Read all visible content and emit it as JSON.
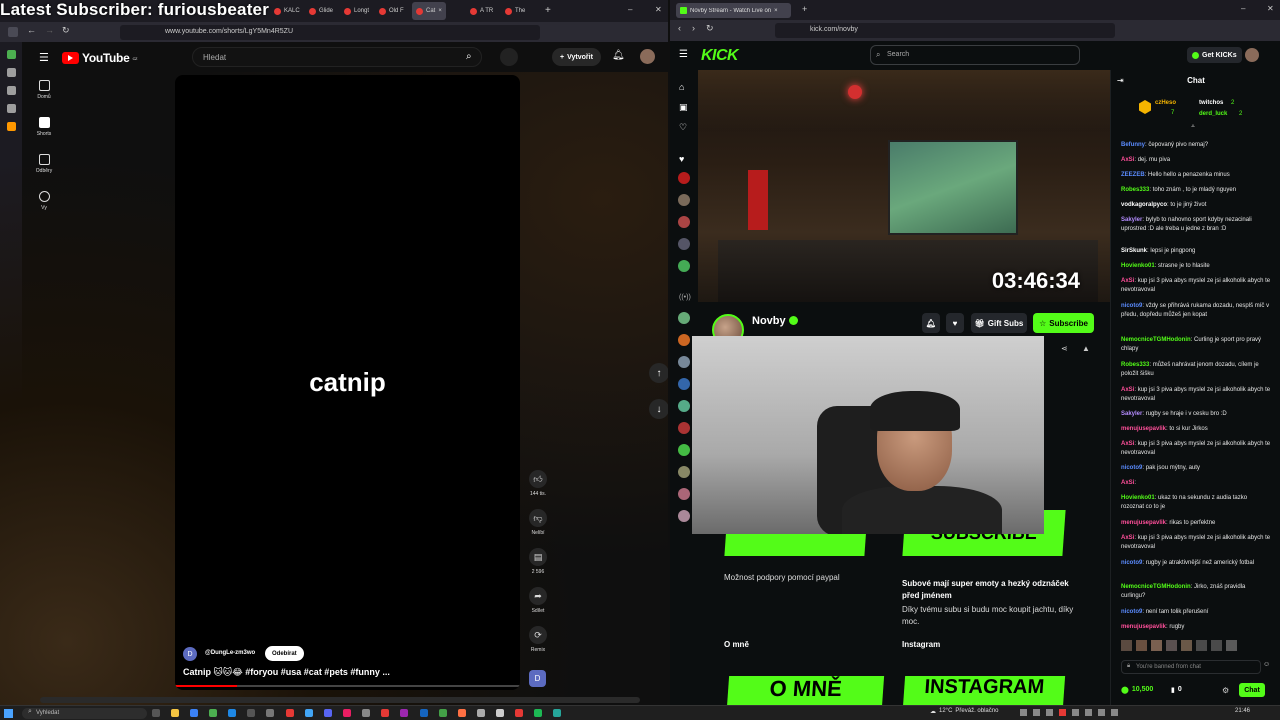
{
  "overlay_text": "Latest Subscriber: furiousbeater",
  "left_browser": {
    "tabs": [
      "KALC",
      "Glide",
      "Longt",
      "Old F",
      "Cat",
      "A TR",
      "The"
    ],
    "url": "www.youtube.com/shorts/LgY5Mn4R5ZU",
    "yt_logo": "YouTube",
    "yt_region": "CZ",
    "search_placeholder": "Hledat",
    "create_label": "Vytvořit",
    "nav": [
      {
        "label": "Domů",
        "icon": "home-icon"
      },
      {
        "label": "Shorts",
        "icon": "shorts-icon"
      },
      {
        "label": "Odběry",
        "icon": "subscriptions-icon"
      },
      {
        "label": "Vy",
        "icon": "you-icon"
      }
    ],
    "short_title": "catnip",
    "channel": "@DungLe-zm3wo",
    "subscribe_label": "Odebírat",
    "caption": "Catnip 🐱🐱😂 #foryou #usa #cat #pets #funny ...",
    "actions": {
      "likes": "144 tis.",
      "dislike": "Nelíbí",
      "comments": "2 596",
      "share": "Sdílet",
      "remix": "Remix"
    }
  },
  "right_browser": {
    "tab_title": "Novby Stream - Watch Live on",
    "url": "kick.com/novby",
    "logo": "KICK",
    "search_placeholder": "Search",
    "get_kicks": "Get KICKs",
    "timer": "03:46:34",
    "channel_name": "Novby",
    "gift_subs": "Gift Subs",
    "subscribe": "Subscribe",
    "panels": [
      {
        "text": "Možnost podpory pomocí paypal"
      },
      {
        "text": "Subové mají super emoty a hezký odznáček před jménem",
        "sub": "Díky tvému subu si budu moc koupit jachtu, díky moc."
      }
    ],
    "panel_banner_right": "SUBSCRIBE",
    "section_about": "O mně",
    "section_instagram": "Instagram",
    "banner_about": "O MNĚ",
    "banner_instagram": "INSTAGRAM"
  },
  "chat": {
    "title": "Chat",
    "top_gifters": [
      {
        "name": "czHeso",
        "count": "7"
      },
      {
        "name": "twitchos",
        "count": "2"
      },
      {
        "name": "derd_luck",
        "count": "2"
      }
    ],
    "messages": [
      {
        "user": "Befunny",
        "color": "#5b8cff",
        "text": "čepovaný pivo nemaj?"
      },
      {
        "user": "AxSi",
        "color": "#ff4f9a",
        "text": "dej. mu piva"
      },
      {
        "user": "ZEEZEB",
        "color": "#5b8cff",
        "text": "Hello hello a penazenka minus"
      },
      {
        "user": "Robes333",
        "color": "#53fc18",
        "text": "toho znám , to je mladý nguyen"
      },
      {
        "user": "vodkagoralpyco",
        "color": "#ffffff",
        "text": "to je jiný život"
      },
      {
        "user": "Sakyler",
        "color": "#b48cff",
        "text": "bylyb to nahovno sport kdyby nezacinali uprostred :D ale treba u jedne z bran :D"
      },
      {
        "user": "SirSkunk",
        "color": "#ffffff",
        "text": "lepsi je pingpong"
      },
      {
        "user": "Hovienko01",
        "color": "#53fc18",
        "text": "strasne je to hlasite"
      },
      {
        "user": "AxSi",
        "color": "#ff4f9a",
        "text": "kup jsi 3 piva abys myslel ze jsi alkoholik abych te nevotravoval"
      },
      {
        "user": "nicoto9",
        "color": "#5b8cff",
        "text": "vždy se přihrává rukama dozadu, nesplš míč v předu, dopředu můžeš jen kopat"
      },
      {
        "user": "NemocniceTGMHodonin",
        "color": "#53fc18",
        "text": "Curling je sport pro pravý chlapy"
      },
      {
        "user": "Robes333",
        "color": "#53fc18",
        "text": "můžeš nahrávat jenom dozadu, cílem je položit šišku"
      },
      {
        "user": "AxSi",
        "color": "#ff4f9a",
        "text": "kup jsi 3 piva abys myslel ze jsi alkoholik abych te nevotravoval"
      },
      {
        "user": "Sakyler",
        "color": "#b48cff",
        "text": "rugby se hraje i v cesku bro :D"
      },
      {
        "user": "menujusepavlik",
        "color": "#ff4f9a",
        "text": "to si kur Jirkos"
      },
      {
        "user": "AxSi",
        "color": "#ff4f9a",
        "text": "kup jsi 3 piva abys myslel ze jsi alkoholik abych te nevotravoval"
      },
      {
        "user": "nicoto9",
        "color": "#5b8cff",
        "text": "pak jsou mýtny, auty"
      },
      {
        "user": "AxSi",
        "color": "#ff4f9a",
        "text": ""
      },
      {
        "user": "Hovienko01",
        "color": "#53fc18",
        "text": "ukaz to na sekundu z audia tazko rozoznat co to je"
      },
      {
        "user": "menujusepavlik",
        "color": "#ff4f9a",
        "text": "rikas to perfektne"
      },
      {
        "user": "AxSi",
        "color": "#ff4f9a",
        "text": "kup jsi 3 piva abys myslel ze jsi alkoholik abych te nevotravoval"
      },
      {
        "user": "nicoto9",
        "color": "#5b8cff",
        "text": "rugby je atraktivnější než americký fotbal"
      },
      {
        "user": "NemocniceTGMHodonin",
        "color": "#53fc18",
        "text": "Jirko, znáš pravidla curlingu?"
      },
      {
        "user": "nicoto9",
        "color": "#5b8cff",
        "text": "není tam tolik přerušení"
      },
      {
        "user": "menujusepavlik",
        "color": "#ff4f9a",
        "text": "rugby"
      }
    ],
    "banned_text": "You're banned from chat",
    "points": "10,500",
    "badge_count": "0",
    "send_label": "Chat"
  },
  "taskbar": {
    "search_placeholder": "Vyhledat",
    "weather": "12°C",
    "weather_desc": "Převáž. oblačno",
    "time": "21:46"
  }
}
